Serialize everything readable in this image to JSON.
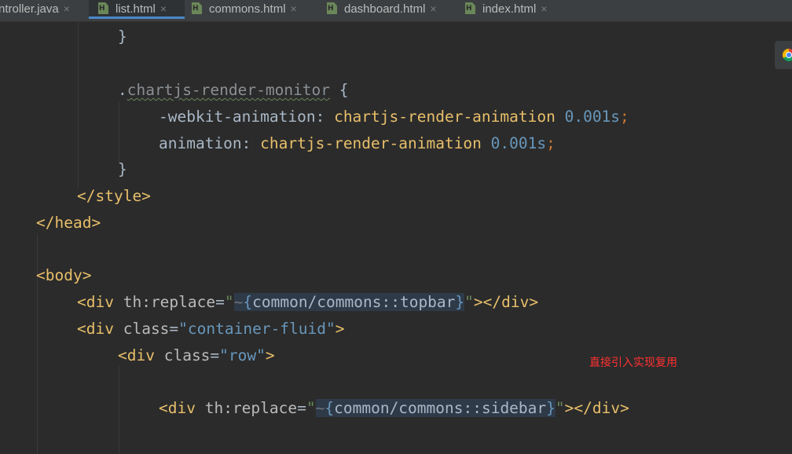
{
  "tabs": [
    {
      "name": "ntroller.java",
      "icon": "java-file-icon",
      "active": false
    },
    {
      "name": "list.html",
      "icon": "html-file-icon",
      "active": true
    },
    {
      "name": "commons.html",
      "icon": "html-file-icon",
      "active": false
    },
    {
      "name": "dashboard.html",
      "icon": "html-file-icon",
      "active": false
    },
    {
      "name": "index.html",
      "icon": "html-file-icon",
      "active": false
    }
  ],
  "tab_close_glyph": "×",
  "tab_file_letter": "H",
  "code": {
    "l1_brace": "}",
    "l3_selector_dot": ".",
    "l3_selector": "chartjs-render-monitor",
    "l3_open": " {",
    "l4_prop": "-webkit-animation:",
    "l4_value": "chartjs-render-animation",
    "l4_num": "0.001s",
    "l4_semi": ";",
    "l5_prop": "animation:",
    "l5_value": "chartjs-render-animation",
    "l5_num": "0.001s",
    "l5_semi": ";",
    "l6_brace": "}",
    "l7_style_close": "</style>",
    "l8_head_close": "</head>",
    "l10_body_open": "<body>",
    "l11_open": "<div",
    "l11_attr": "th:replace",
    "l11_eq": "=",
    "l11_q1": "\"",
    "l11_tilde": "~",
    "l11_lb": "{",
    "l11_expr": "common/commons::topbar",
    "l11_rb": "}",
    "l11_q2": "\"",
    "l11_close": "></div>",
    "l12_open": "<div",
    "l12_attr": "class",
    "l12_eq": "=",
    "l12_val": "\"container-fluid\"",
    "l12_close": ">",
    "l13_open": "<div",
    "l13_attr": "class",
    "l13_eq": "=",
    "l13_val": "\"row\"",
    "l13_close": ">",
    "l15_open": "<div",
    "l15_attr": "th:replace",
    "l15_eq": "=",
    "l15_q1": "\"",
    "l15_tilde": "~",
    "l15_lb": "{",
    "l15_expr": "common/commons::sidebar",
    "l15_rb": "}",
    "l15_q2": "\"",
    "l15_close": "></div>"
  },
  "annotation": "直接引入实现复用",
  "side_widget_icon": "chrome-icon"
}
